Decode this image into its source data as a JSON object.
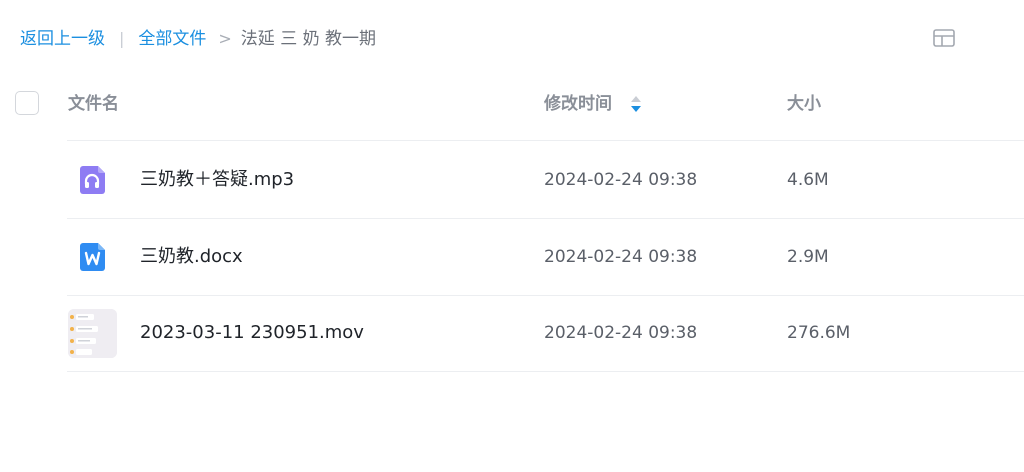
{
  "breadcrumb": {
    "back_label": "返回上一级",
    "divider": "|",
    "all_files_label": "全部文件",
    "separator": ">",
    "current_folder": "法延 三 奶 教一期"
  },
  "view_toggle": {
    "icon": "grid-view-icon"
  },
  "table": {
    "columns": {
      "name": "文件名",
      "modified": "修改时间",
      "size": "大小"
    },
    "sort": {
      "column": "modified",
      "direction": "descending"
    },
    "rows": [
      {
        "name": "三奶教＋答疑.mp3",
        "modified": "2024-02-24 09:38",
        "size": "4.6M",
        "icon": "audio-file-icon"
      },
      {
        "name": "三奶教.docx",
        "modified": "2024-02-24 09:38",
        "size": "2.9M",
        "icon": "word-file-icon"
      },
      {
        "name": "2023-03-11 230951.mov",
        "modified": "2024-02-24 09:38",
        "size": "276.6M",
        "icon": "video-thumbnail"
      }
    ]
  },
  "colors": {
    "link": "#1b8fe0",
    "audio_icon": "#8e7cf3",
    "word_icon": "#2f8cf2",
    "sort_active": "#1b8fe0"
  }
}
